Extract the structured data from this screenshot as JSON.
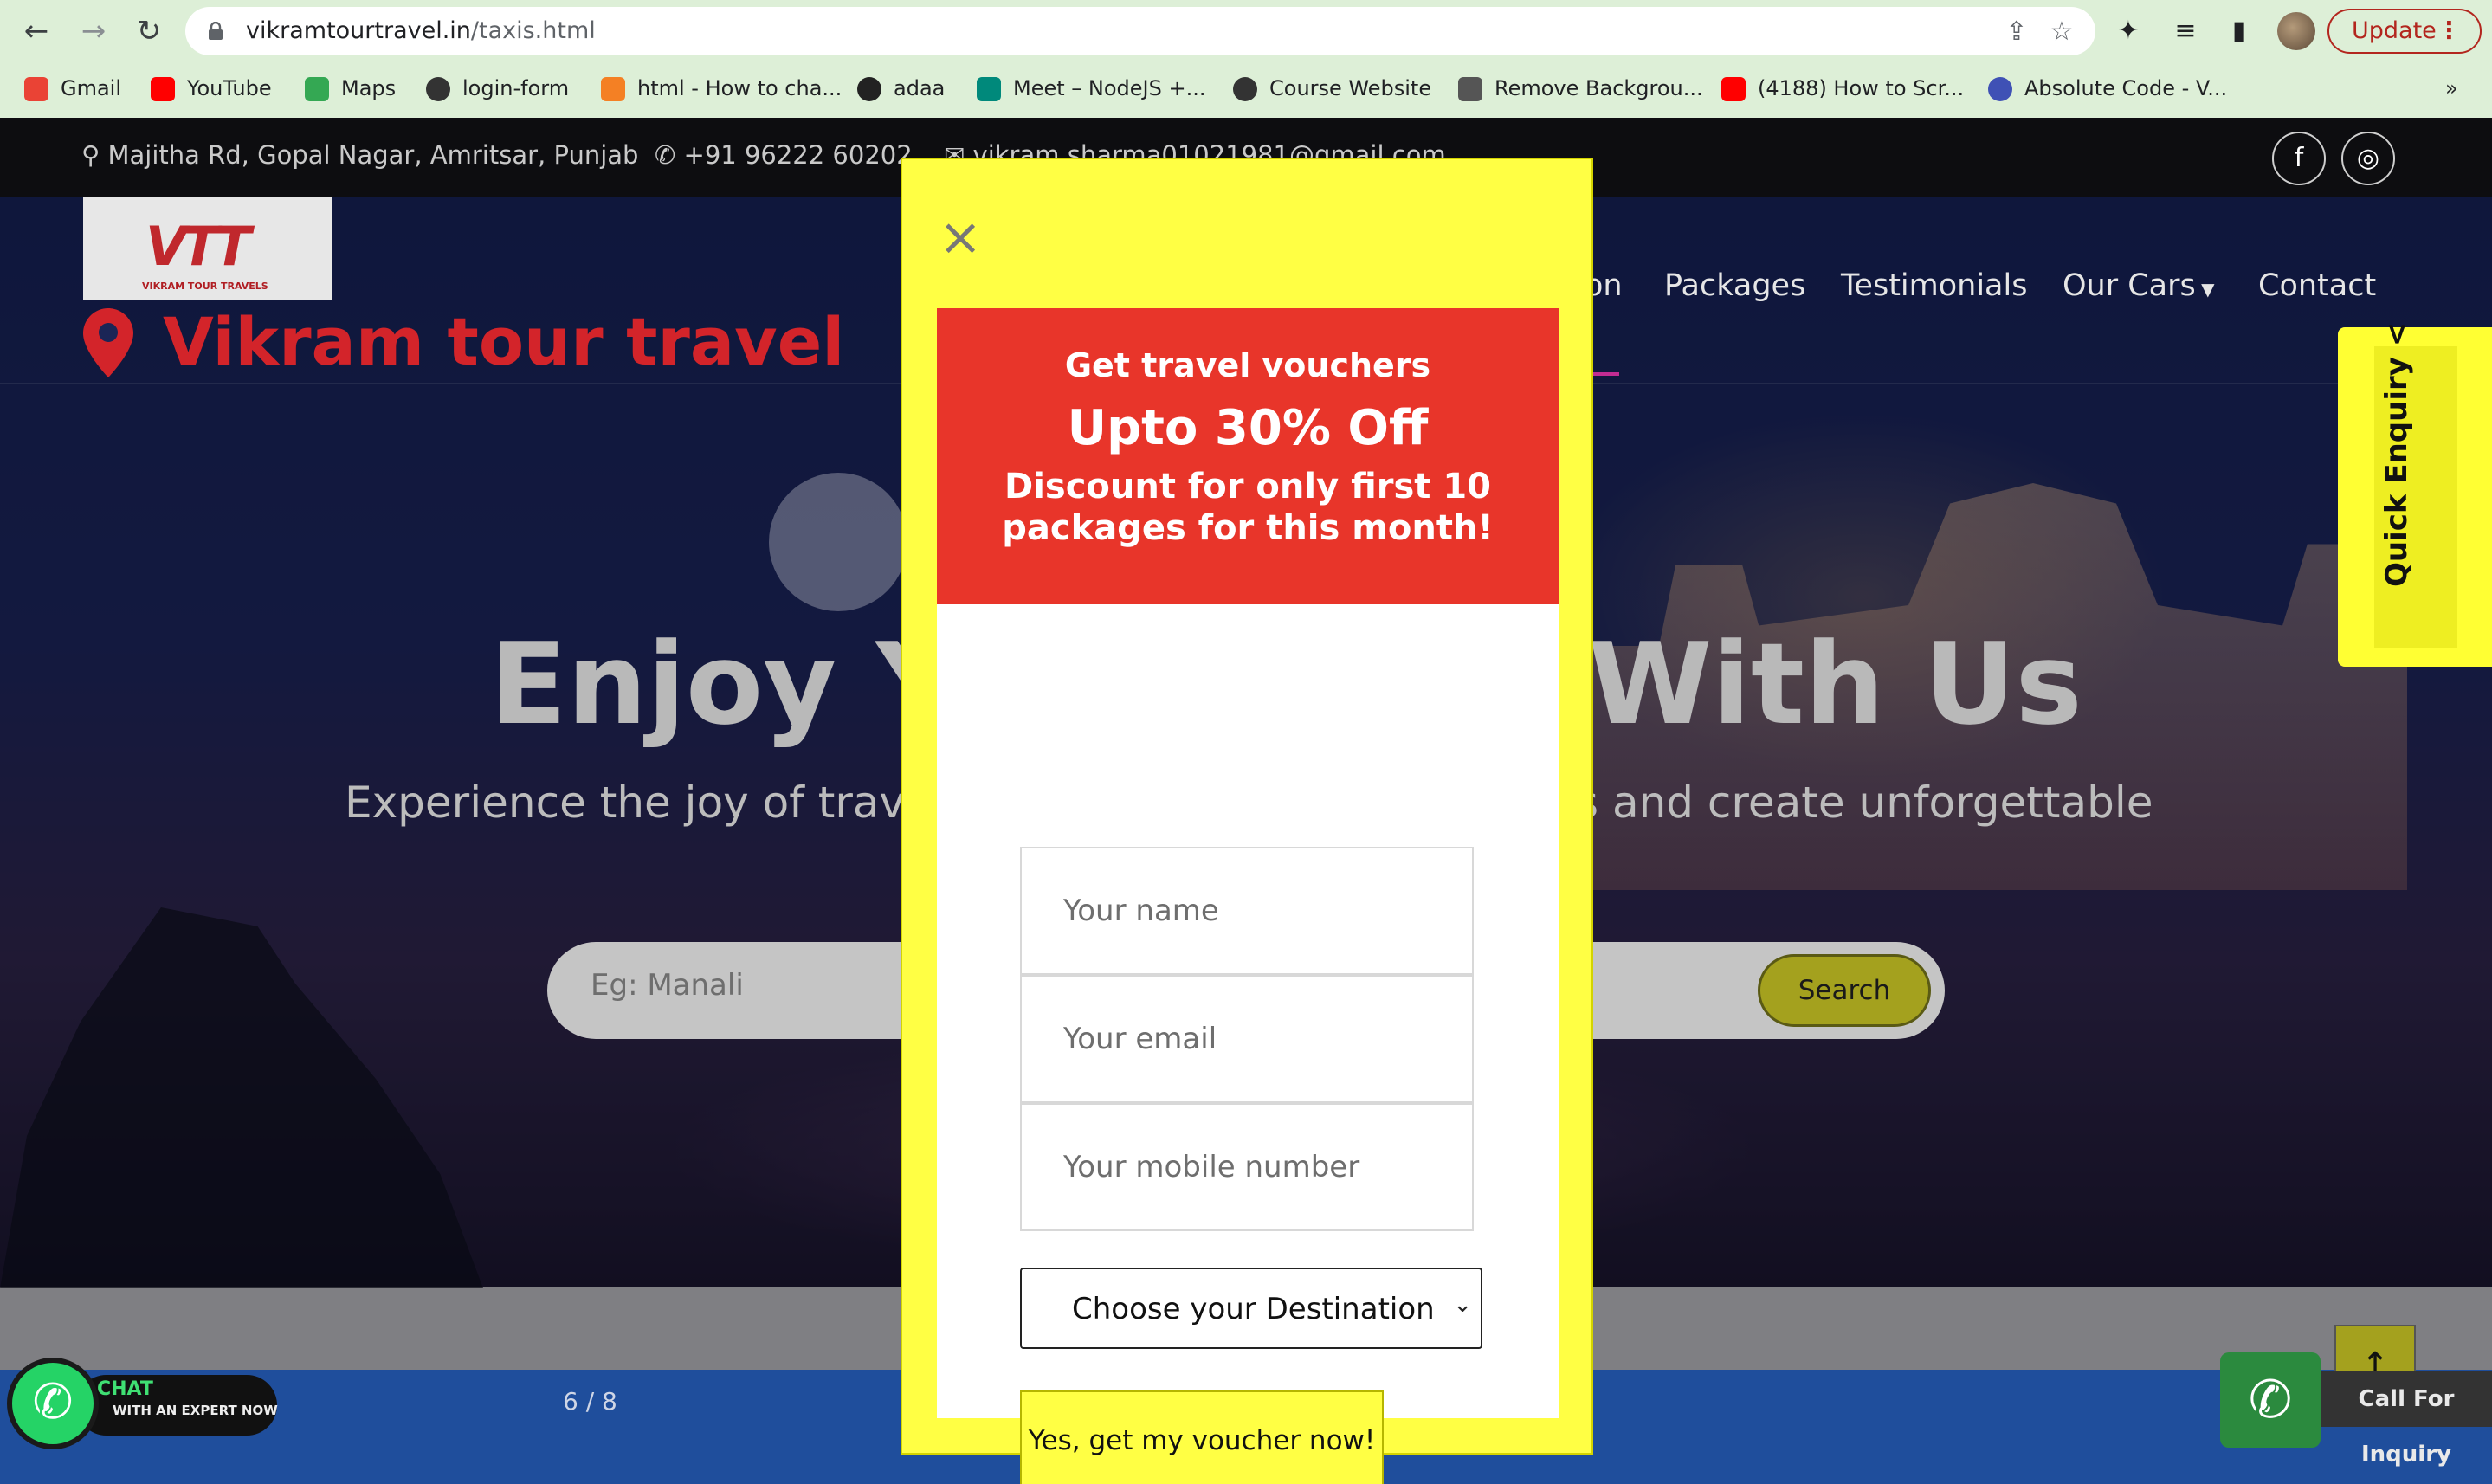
{
  "browser": {
    "url_domain": "vikramtourtravel.in",
    "url_path": "/taxis.html",
    "update_label": "Update",
    "bookmarks": [
      {
        "label": "Gmail",
        "icon": "gmail-icon",
        "color": "#ea4335"
      },
      {
        "label": "YouTube",
        "icon": "youtube-icon",
        "color": "#ff0000"
      },
      {
        "label": "Maps",
        "icon": "maps-icon",
        "color": "#34a853"
      },
      {
        "label": "login-form",
        "icon": "globe-icon",
        "color": "#333333"
      },
      {
        "label": "html - How to cha...",
        "icon": "stackoverflow-icon",
        "color": "#f48024"
      },
      {
        "label": "adaa",
        "icon": "adaa-icon",
        "color": "#222222"
      },
      {
        "label": "Meet – NodeJS +...",
        "icon": "meet-icon",
        "color": "#00897b"
      },
      {
        "label": "Course Website",
        "icon": "globe-icon",
        "color": "#333333"
      },
      {
        "label": "Remove Backgrou...",
        "icon": "removebg-icon",
        "color": "#555555"
      },
      {
        "label": "(4188) How to Scr...",
        "icon": "youtube-icon",
        "color": "#ff0000"
      },
      {
        "label": "Absolute Code - V...",
        "icon": "absolute-code-icon",
        "color": "#3f51b5"
      }
    ],
    "more_bookmarks": "»"
  },
  "site": {
    "topbar": {
      "address": "Majitha Rd, Gopal Nagar, Amritsar, Punjab",
      "phone": "+91 96222 60202",
      "email": "vikram.sharma01021981@gmail.com"
    },
    "logo_text": "VTT",
    "logo_tag": "VIKRAM TOUR TRAVELS",
    "brand": "Vikram tour travel",
    "menu_partial": "on",
    "menu": [
      "Packages",
      "Testimonials",
      "Our Cars",
      "Contact"
    ],
    "hero_title_left": "Enjoy Yo",
    "hero_title_right": "With Us",
    "hero_sub_left": "Experience the joy of trave",
    "hero_sub_right": "s and create unforgettable",
    "search_placeholder": "Eg: Manali",
    "search_button": "Search",
    "quick_enquiry": "Quick Enquiry",
    "quick_arrow": "<",
    "pager": "6 / 8",
    "chat_line1": "CHAT",
    "chat_line2": "WITH AN EXPERT NOW",
    "call_label": "Call For Inquiry",
    "accent_color": "#d3242a"
  },
  "modal": {
    "close": "×",
    "promo_line1": "Get travel vouchers",
    "promo_line2": "Upto 30% Off",
    "promo_line3a": "Discount for only first 10",
    "promo_line3b": "packages for this month!",
    "name_placeholder": "Your name",
    "email_placeholder": "Your email",
    "mobile_placeholder": "Your mobile number",
    "destination_selected": "Choose your Destination",
    "submit": "Yes, get my voucher now!",
    "colors": {
      "background": "#ffff44",
      "promo": "#e8352a"
    }
  }
}
